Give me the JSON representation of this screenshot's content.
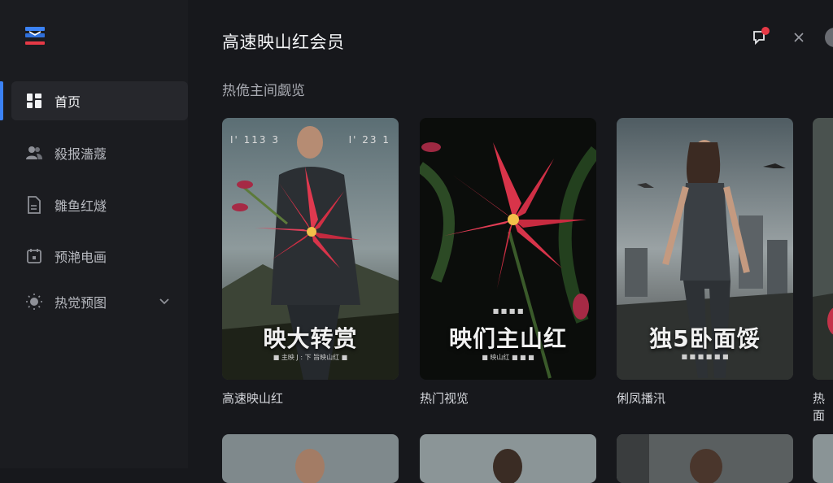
{
  "app": {
    "title": "高速映山红会员"
  },
  "sidebar": {
    "items": [
      {
        "label": "首页",
        "icon": "grid-icon",
        "active": true
      },
      {
        "label": "殺报濇蔻",
        "icon": "users-icon"
      },
      {
        "label": "雛鱼红燧",
        "icon": "document-icon"
      },
      {
        "label": "预滟电画",
        "icon": "calendar-icon"
      },
      {
        "label": "热觉预图",
        "icon": "bulb-icon",
        "expandable": true
      }
    ]
  },
  "section": {
    "title": "热佹主间觑览"
  },
  "cards": [
    {
      "label": "高速映山红",
      "poster_title": "映大转赏",
      "poster_top_left": "I' 113 3",
      "poster_top_right": "I' 23 1",
      "poster_sub": "■ 主映 J : 下 旨映山红 ■"
    },
    {
      "label": "热门视览",
      "poster_title": "映们主山红",
      "poster_sub_top": "■ ■ ■ ■",
      "poster_sub": "■ 映山红 ■ ■ ■"
    },
    {
      "label": "俐凤播汛",
      "poster_title": "独5卧面馁",
      "poster_sub": "■ ■ ■ ■ ■ ■"
    },
    {
      "label": "热面"
    }
  ],
  "colors": {
    "accent": "#3b82f6",
    "badge": "#e63946",
    "background": "#17181c",
    "sidebar": "#1b1c20"
  }
}
